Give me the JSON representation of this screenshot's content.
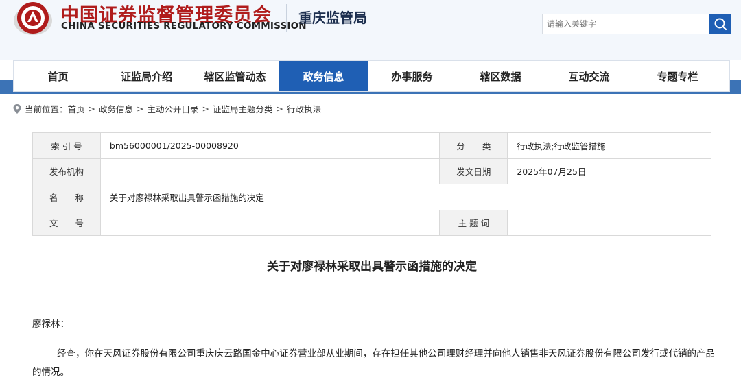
{
  "header": {
    "logo_cn": "中国证券监督管理委员会",
    "logo_en": "CHINA SECURITIES REGULATORY COMMISSION",
    "bureau_name": "重庆监管局",
    "brand_color": "#b01c1c",
    "nav_color": "#1f5fb4"
  },
  "search": {
    "placeholder": "请输入关键字",
    "icon": "search-icon"
  },
  "nav": {
    "items": [
      {
        "label": "首页"
      },
      {
        "label": "证监局介绍"
      },
      {
        "label": "辖区监管动态"
      },
      {
        "label": "政务信息",
        "active": true
      },
      {
        "label": "办事服务"
      },
      {
        "label": "辖区数据"
      },
      {
        "label": "互动交流"
      },
      {
        "label": "专题专栏"
      }
    ]
  },
  "breadcrumb": {
    "icon": "location-pin-icon",
    "prefix": "当前位置：",
    "items": [
      "首页",
      "政务信息",
      "主动公开目录",
      "证监局主题分类",
      "行政执法"
    ],
    "separator": ">"
  },
  "meta_table": {
    "index_label": "索 引 号",
    "index_value": "bm56000001/2025-00008920",
    "category_label": "分　　类",
    "category_value": "行政执法;行政监管措施",
    "issuer_label": "发布机构",
    "issuer_value": "",
    "date_label": "发文日期",
    "date_value": "2025年07月25日",
    "name_label": "名　　称",
    "name_value": "关于对廖禄林采取出具警示函措施的决定",
    "doc_no_label": "文　　号",
    "doc_no_value": "",
    "subject_label": "主 题 词",
    "subject_value": ""
  },
  "document": {
    "title": "关于对廖禄林采取出具警示函措施的决定",
    "salutation": "廖禄林：",
    "paragraph1": "经查，你在天风证券股份有限公司重庆庆云路国金中心证券营业部从业期间，存在担任其他公司理财经理并向他人销售非天风证券股份有限公司发行或代销的产品的情况。"
  }
}
